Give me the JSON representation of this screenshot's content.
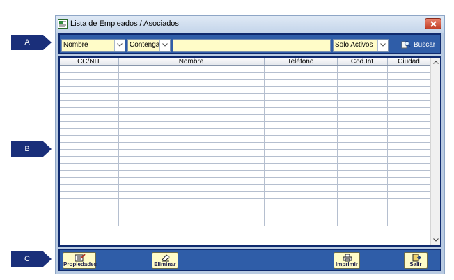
{
  "markers": [
    {
      "label": "A"
    },
    {
      "label": "B"
    },
    {
      "label": "C"
    }
  ],
  "window": {
    "title": "Lista de Empleados / Asociados"
  },
  "search": {
    "field_value": "Nombre",
    "operator_value": "Contenga",
    "query_value": "",
    "status_value": "Solo Activos",
    "search_label": "Buscar"
  },
  "table": {
    "columns": [
      "CC/NIT",
      "Nombre",
      "Teléfono",
      "Cod.Int",
      "Ciudad"
    ],
    "row_count": 23,
    "rows": []
  },
  "toolbar": {
    "properties_label": "Propiedades",
    "delete_label": "Eliminar",
    "print_label": "Imprimir",
    "exit_label": "Salir"
  },
  "colors": {
    "bar_blue": "#2f5da8",
    "border_navy": "#0f2a6e",
    "field_yellow": "#fffcc8",
    "marker_navy": "#1a2f7a"
  }
}
